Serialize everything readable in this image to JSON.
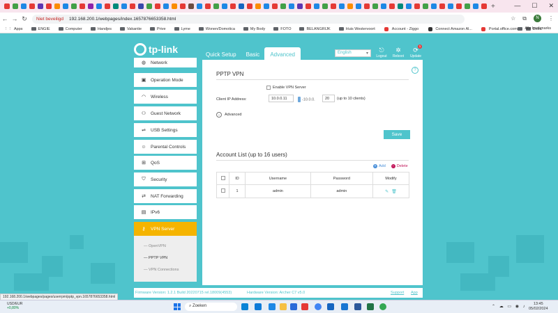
{
  "browser": {
    "security_label": "Niet beveiligd",
    "url": "192.168.200.1/webpages/index.1657876653358.html",
    "new_tab": "+",
    "window_controls": [
      "—",
      "☐",
      "✕"
    ],
    "profile_initial": "N",
    "status_url": "192.168.200.1/webpages/pages/userrpm/pptp_vpn.1657876653358.html"
  },
  "bookmarks": {
    "items": [
      "Apps",
      "ENGIE",
      "Computer",
      "Handjes",
      "Vakantie",
      "Prive",
      "Lyme",
      "Wonen/Domotica",
      "My Body",
      "FOTO",
      "BELANGRIJK",
      "Huis Westervoort",
      "Account - Ziggo",
      "Connect Amazon Al...",
      "Portal.office.com",
      "Delta"
    ],
    "all_label": "Alle bookmarks"
  },
  "router": {
    "logo_text": "tp-link",
    "tabs": [
      "Quick Setup",
      "Basic",
      "Advanced"
    ],
    "language": "English",
    "top_icons": [
      {
        "label": "Logout",
        "icon": "logout-icon"
      },
      {
        "label": "Reboot",
        "icon": "reboot-icon"
      },
      {
        "label": "Update",
        "icon": "update-icon",
        "badge": "1"
      }
    ],
    "sidebar": [
      {
        "label": "Network",
        "icon": "globe-icon"
      },
      {
        "label": "Operation Mode",
        "icon": "mode-icon"
      },
      {
        "label": "Wireless",
        "icon": "wifi-icon"
      },
      {
        "label": "Guest Network",
        "icon": "guest-icon"
      },
      {
        "label": "USB Settings",
        "icon": "usb-icon"
      },
      {
        "label": "Parental Controls",
        "icon": "parental-icon"
      },
      {
        "label": "QoS",
        "icon": "qos-icon"
      },
      {
        "label": "Security",
        "icon": "shield-icon"
      },
      {
        "label": "NAT Forwarding",
        "icon": "nat-icon"
      },
      {
        "label": "IPv6",
        "icon": "ipv6-icon"
      },
      {
        "label": "VPN Server",
        "icon": "vpn-icon"
      }
    ],
    "subnav": [
      "OpenVPN",
      "PPTP VPN",
      "VPN Connections"
    ],
    "pptp": {
      "title": "PPTP VPN",
      "enable_label": "Enable VPN Server",
      "ip_label": "Client IP Address:",
      "ip_start": "10.0.0.11",
      "ip_mid": "-10.0.0.",
      "ip_end": "20",
      "ip_note": "(up to 10 clients)",
      "advanced_label": "Advanced",
      "save_label": "Save"
    },
    "accounts": {
      "title": "Account List (up to 16 users)",
      "add_label": "Add",
      "delete_label": "Delete",
      "columns": [
        "ID",
        "Username",
        "Password",
        "Modify"
      ],
      "rows": [
        {
          "id": "1",
          "username": "admin",
          "password": "admin"
        }
      ]
    },
    "footer": {
      "firmware": "Firmware Version: 1.2.1 Build 20220715 rel.18009(4553)",
      "hardware": "Hardware Version: Archer C7 v5.0",
      "support": "Support",
      "app": "App"
    }
  },
  "taskbar": {
    "ticker_pair": "USD/EUR",
    "ticker_change": "+0,80%",
    "search_placeholder": "Zoeken",
    "time": "13:45",
    "date": "05/02/2024"
  }
}
